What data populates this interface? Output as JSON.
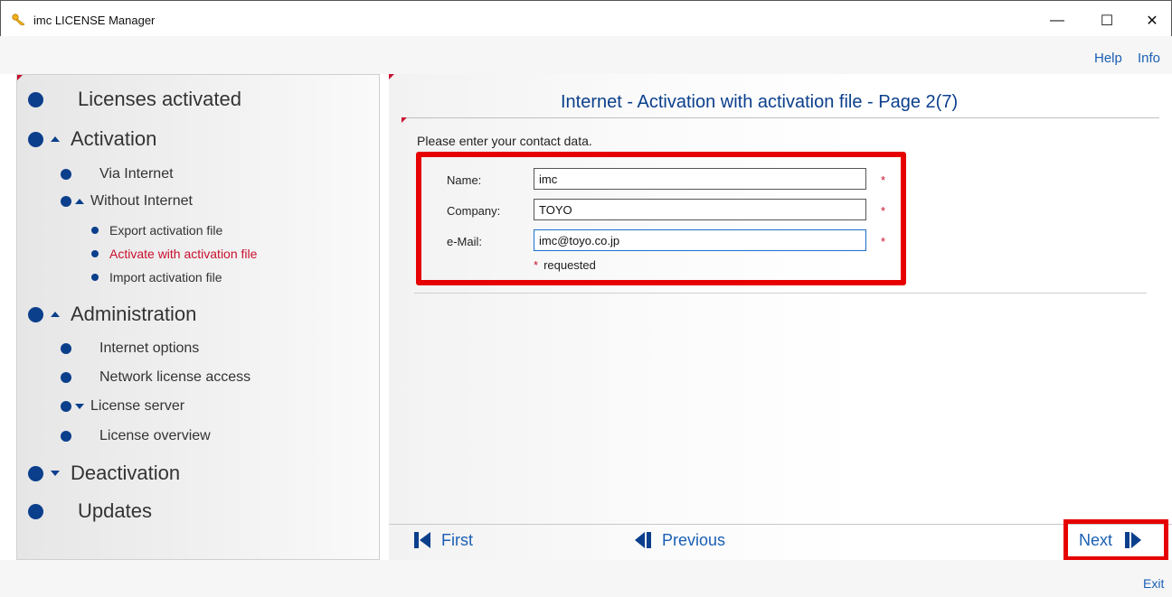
{
  "window": {
    "title": "imc LICENSE Manager",
    "minimize_glyph": "—",
    "maximize_glyph": "☐",
    "close_glyph": "✕"
  },
  "top_links": {
    "help": "Help",
    "info": "Info"
  },
  "nav": {
    "licenses_activated": "Licenses activated",
    "activation": "Activation",
    "via_internet": "Via Internet",
    "without_internet": "Without Internet",
    "export_activation_file": "Export activation file",
    "activate_with_activation_file": "Activate with activation file",
    "import_activation_file": "Import activation file",
    "administration": "Administration",
    "internet_options": "Internet options",
    "network_license_access": "Network license access",
    "license_server": "License server",
    "license_overview": "License overview",
    "deactivation": "Deactivation",
    "updates": "Updates"
  },
  "content": {
    "page_title": "Internet - Activation with activation file - Page 2(7)",
    "intro": "Please enter your contact data.",
    "form": {
      "name_label": "Name:",
      "name_value": "imc",
      "company_label": "Company:",
      "company_value": "TOYO",
      "email_label": "e-Mail:",
      "email_value": "imc@toyo.co.jp",
      "required_star": "*",
      "required_note": "requested"
    }
  },
  "buttons": {
    "first": "First",
    "previous": "Previous",
    "next": "Next"
  },
  "footer": {
    "exit": "Exit"
  },
  "colors": {
    "accent_blue": "#0b3f8c",
    "link_blue": "#1a5fb4",
    "active_red": "#c8102e",
    "highlight_red": "#e60000"
  }
}
